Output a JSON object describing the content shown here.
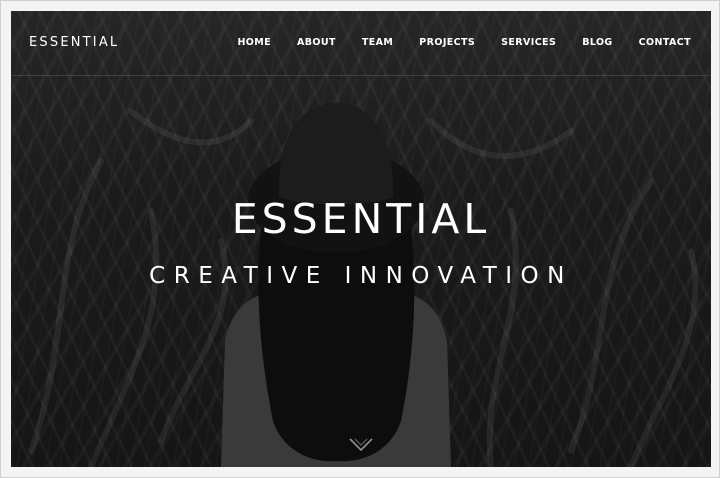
{
  "brand": {
    "logo_text": "ESSENTIAL"
  },
  "nav": {
    "items": [
      {
        "label": "HOME"
      },
      {
        "label": "ABOUT"
      },
      {
        "label": "TEAM"
      },
      {
        "label": "PROJECTS"
      },
      {
        "label": "SERVICES"
      },
      {
        "label": "BLOG"
      },
      {
        "label": "CONTACT"
      }
    ]
  },
  "hero": {
    "title": "ESSENTIAL",
    "subtitle": "CREATIVE INNOVATION",
    "scroll_icon": "chevron-down-icon",
    "background": "dark monochrome photo"
  },
  "colors": {
    "text": "#ffffff",
    "background": "#1b1b1b",
    "page": "#f4f4f4"
  }
}
